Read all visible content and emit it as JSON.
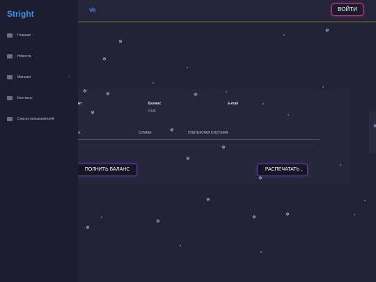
{
  "brand": "Stright",
  "header": {
    "vk_icon": "vk-icon",
    "vk_label": "vk",
    "login_label": "ВОЙТИ"
  },
  "sidebar": {
    "items": [
      {
        "label": "Главная",
        "icon": "home-icon"
      },
      {
        "label": "Новости",
        "icon": "news-icon"
      },
      {
        "label": "Магазин",
        "icon": "cart-icon",
        "chevron": "›"
      },
      {
        "label": "Контакты",
        "icon": "user-icon"
      },
      {
        "label": "Список пользователей",
        "icon": "list-icon"
      }
    ]
  },
  "profile": {
    "col1_head": "нт",
    "balance_head": "Баланс",
    "balance_value": "RUB",
    "email_head": "E-mail"
  },
  "table": {
    "headers": [
      "А",
      "СУММА",
      "ПЛАТЕЖНАЯ СИСТЕМА"
    ]
  },
  "buttons": {
    "topup_label": "ПОЛНИТЬ БАЛАНС",
    "print_label": "РАСПЕЧАТАТЬ"
  },
  "colors": {
    "background": "#222236",
    "sidebar": "#1c1d2e",
    "brand": "#3d8fe8",
    "login_border": "#c23a8a",
    "button_border": "#5a3b9a",
    "snow": "#9fc6f0"
  }
}
